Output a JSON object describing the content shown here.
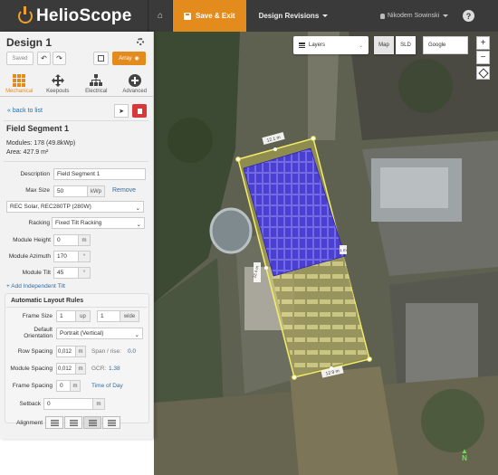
{
  "app": {
    "logo_text": "HelioScope",
    "nav": {
      "save_label": "Save & Exit",
      "revisions_label": "Design Revisions",
      "user_name": "Nikodem Sowinski",
      "help_label": "?"
    }
  },
  "sidebar": {
    "design_title": "Design 1",
    "toolbar": {
      "saved_label": "Saved",
      "undo_label": "↶",
      "redo_label": "↷",
      "array_label": "Array"
    },
    "tabs": [
      {
        "label": "Mechanical",
        "icon": "grid-icon",
        "active": true
      },
      {
        "label": "Keepouts",
        "icon": "move-icon",
        "active": false
      },
      {
        "label": "Electrical",
        "icon": "tree-icon",
        "active": false
      },
      {
        "label": "Advanced",
        "icon": "plus-circle-icon",
        "active": false
      }
    ],
    "back_label": "« back to list",
    "segment": {
      "title": "Field Segment 1",
      "modules_text": "Modules: 178 (49.8kWp)",
      "area_text": "Area: 427.9 m²"
    },
    "form": {
      "description_label": "Description",
      "description_value": "Field Segment 1",
      "max_size_label": "Max Size",
      "max_size_value": "50",
      "max_size_unit": "kWp",
      "remove_label": "Remove",
      "module_select": "REC Solar, REC280TP (280W)",
      "racking_label": "Racking",
      "racking_value": "Fixed Tilt Racking",
      "module_height_label": "Module Height",
      "module_height_value": "0",
      "module_height_unit": "m",
      "module_azimuth_label": "Module Azimuth",
      "module_azimuth_value": "170",
      "module_azimuth_unit": "°",
      "module_tilt_label": "Module Tilt",
      "module_tilt_value": "45",
      "module_tilt_unit": "°",
      "add_tilt_label": "+ Add Independent Tilt"
    },
    "auto_layout": {
      "title": "Automatic Layout Rules",
      "frame_size_label": "Frame Size",
      "frame_up_value": "1",
      "frame_up_unit": "up",
      "frame_wide_value": "1",
      "frame_wide_unit": "wide",
      "orientation_label_1": "Default",
      "orientation_label_2": "Orientation",
      "orientation_value": "Portrait (Vertical)",
      "row_spacing_label": "Row Spacing",
      "row_spacing_value": "0,012",
      "row_spacing_unit": "m",
      "span_rise_label": "Span / rise:",
      "span_rise_value": "0.0",
      "module_spacing_label": "Module Spacing",
      "module_spacing_value": "0,012",
      "module_spacing_unit": "m",
      "gcr_label": "GCR:",
      "gcr_value": "1.38",
      "frame_spacing_label": "Frame Spacing",
      "frame_spacing_value": "0",
      "frame_spacing_unit": "m",
      "time_of_day_label": "Time of Day"
    },
    "setback_label": "Setback",
    "setback_value": "0",
    "setback_unit": "m",
    "alignment_label": "Alignment"
  },
  "map": {
    "layers_label": "Layers",
    "map_btn": "Map",
    "sld_btn": "SLD",
    "provider": "Google",
    "zoom_in": "+",
    "zoom_out": "−",
    "dim_top": "12.1 m",
    "dim_bottom": "12.9 m",
    "dim_left": "22.4 m",
    "dim_right": "1 m",
    "north_label": "N"
  },
  "colors": {
    "accent": "#e38b1c",
    "panel_blue": "#4a3fd0",
    "selection_yellow": "#e8e14a",
    "link": "#2a6fa8"
  }
}
